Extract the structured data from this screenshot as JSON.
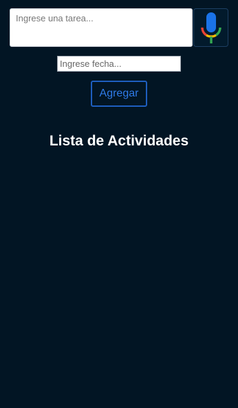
{
  "task_input": {
    "placeholder": "Ingrese una tarea...",
    "value": ""
  },
  "mic_button": {
    "icon": "microphone-icon",
    "colors": {
      "mic": "#1a73e8",
      "left": "#ea4335",
      "bottom": "#fbbc04",
      "right": "#34a853"
    }
  },
  "date_input": {
    "placeholder": "Ingrese fecha...",
    "value": ""
  },
  "add_button": {
    "label": "Agregar"
  },
  "list": {
    "title": "Lista de Actividades",
    "items": []
  },
  "colors": {
    "background": "#021524",
    "accent": "#2f7be8"
  }
}
